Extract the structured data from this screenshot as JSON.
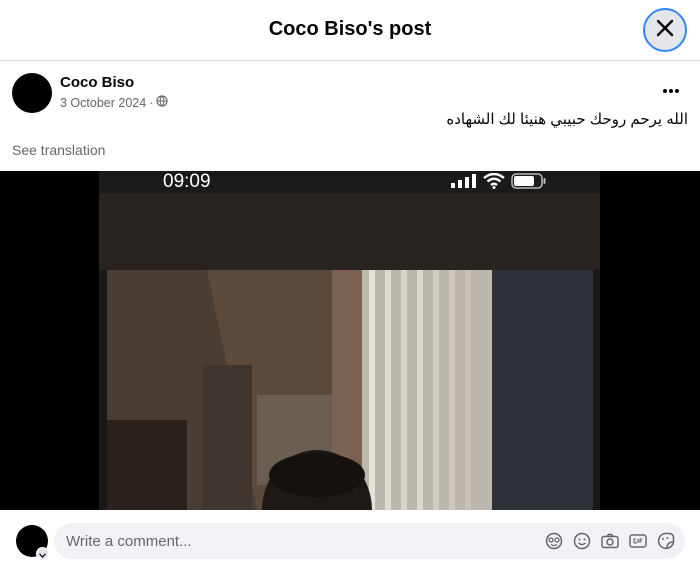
{
  "header": {
    "title": "Coco Biso's post",
    "close_icon": "close-icon"
  },
  "post": {
    "author": "Coco Biso",
    "date": "3 October 2024",
    "separator": "·",
    "privacy_icon": "globe-icon",
    "more_icon": "more-horizontal-icon",
    "text": "الله يرحم روحك حبيبي هنيئا لك الشهاده",
    "see_translation": "See translation"
  },
  "media": {
    "clock": "09:09",
    "status_icons": [
      "signal-icon",
      "wifi-icon",
      "battery-icon"
    ]
  },
  "comment": {
    "placeholder": "Write a comment...",
    "icons": [
      "avatar-sticker-icon",
      "emoji-icon",
      "camera-icon",
      "gif-icon",
      "sticker-icon"
    ]
  },
  "colors": {
    "accent": "#2d88ff",
    "secondary_text": "#65676b",
    "input_bg": "#f0f2f5"
  }
}
